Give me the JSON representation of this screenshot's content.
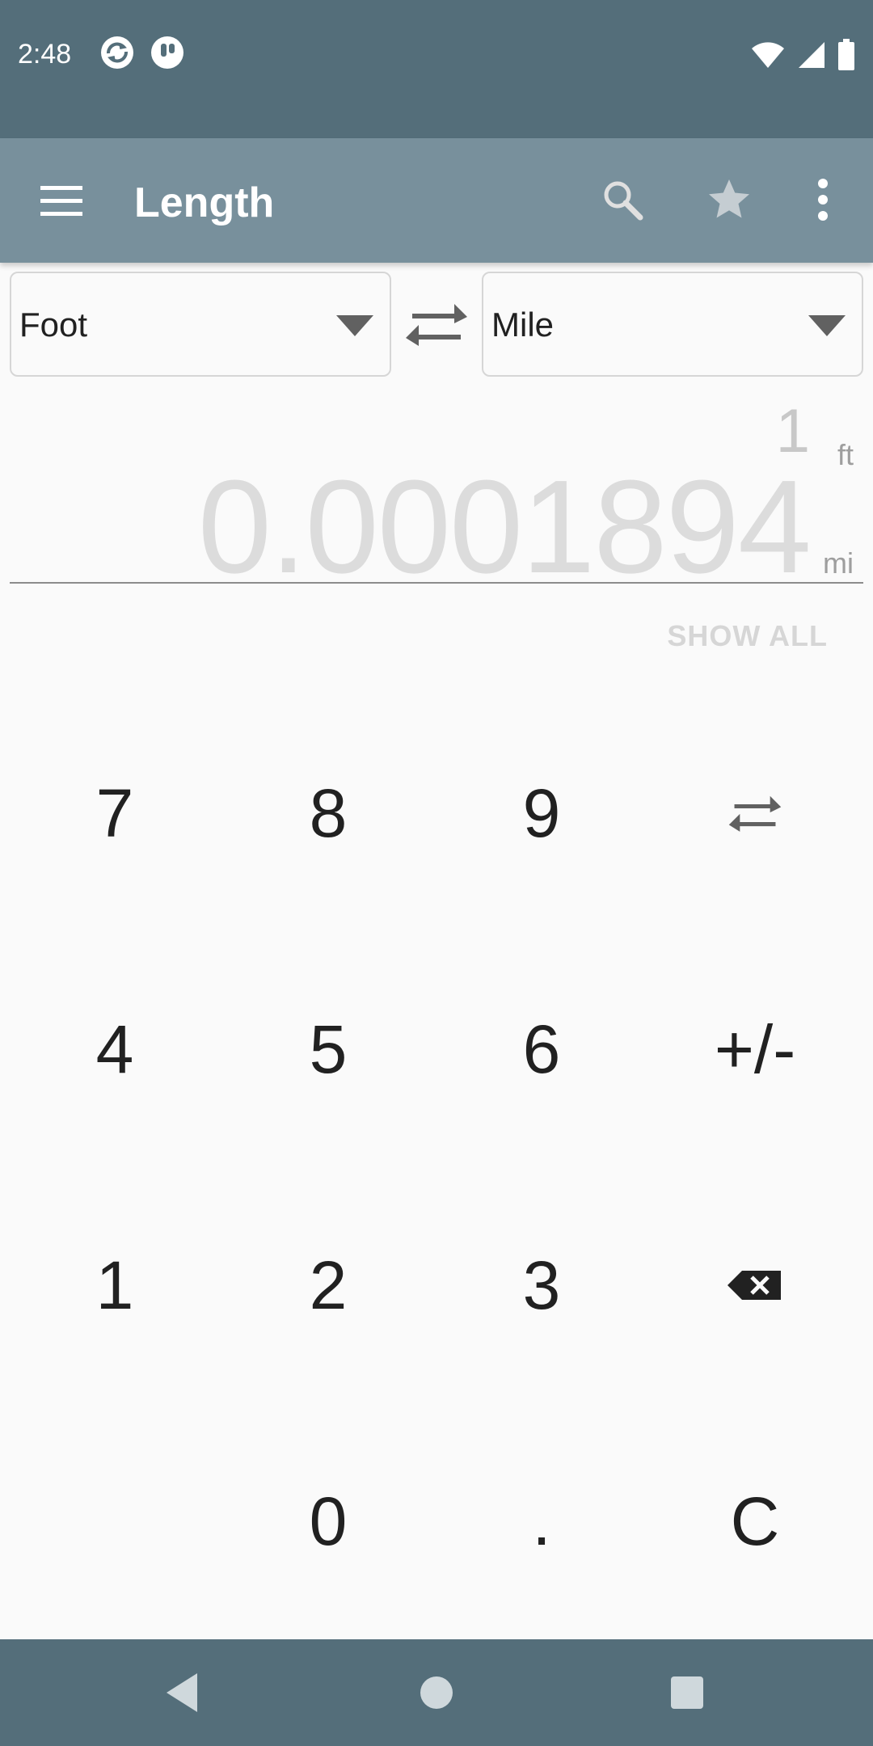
{
  "status_bar": {
    "time": "2:48",
    "icons": [
      "app-icon-1",
      "app-icon-2",
      "wifi-icon",
      "signal-icon",
      "battery-icon"
    ]
  },
  "app_bar": {
    "title": "Length",
    "icons": [
      "menu-icon",
      "search-icon",
      "star-icon",
      "more-vert-icon"
    ]
  },
  "converter": {
    "from_unit": "Foot",
    "to_unit": "Mile",
    "input_value": "1",
    "input_unit": "ft",
    "result_value": "0.0001894",
    "result_unit": "mi",
    "show_all_label": "SHOW ALL"
  },
  "keypad": {
    "k7": "7",
    "k8": "8",
    "k9": "9",
    "k4": "4",
    "k5": "5",
    "k6": "6",
    "sign": "+/-",
    "k1": "1",
    "k2": "2",
    "k3": "3",
    "k0": "0",
    "dot": ".",
    "clear": "C",
    "icons": [
      "swap-icon",
      "backspace-icon"
    ]
  },
  "nav_bar": {
    "icons": [
      "back-icon",
      "home-icon",
      "recents-icon"
    ]
  },
  "colors": {
    "status_bar": "#546e7a",
    "app_bar": "#78909c",
    "background": "#fafafa"
  }
}
